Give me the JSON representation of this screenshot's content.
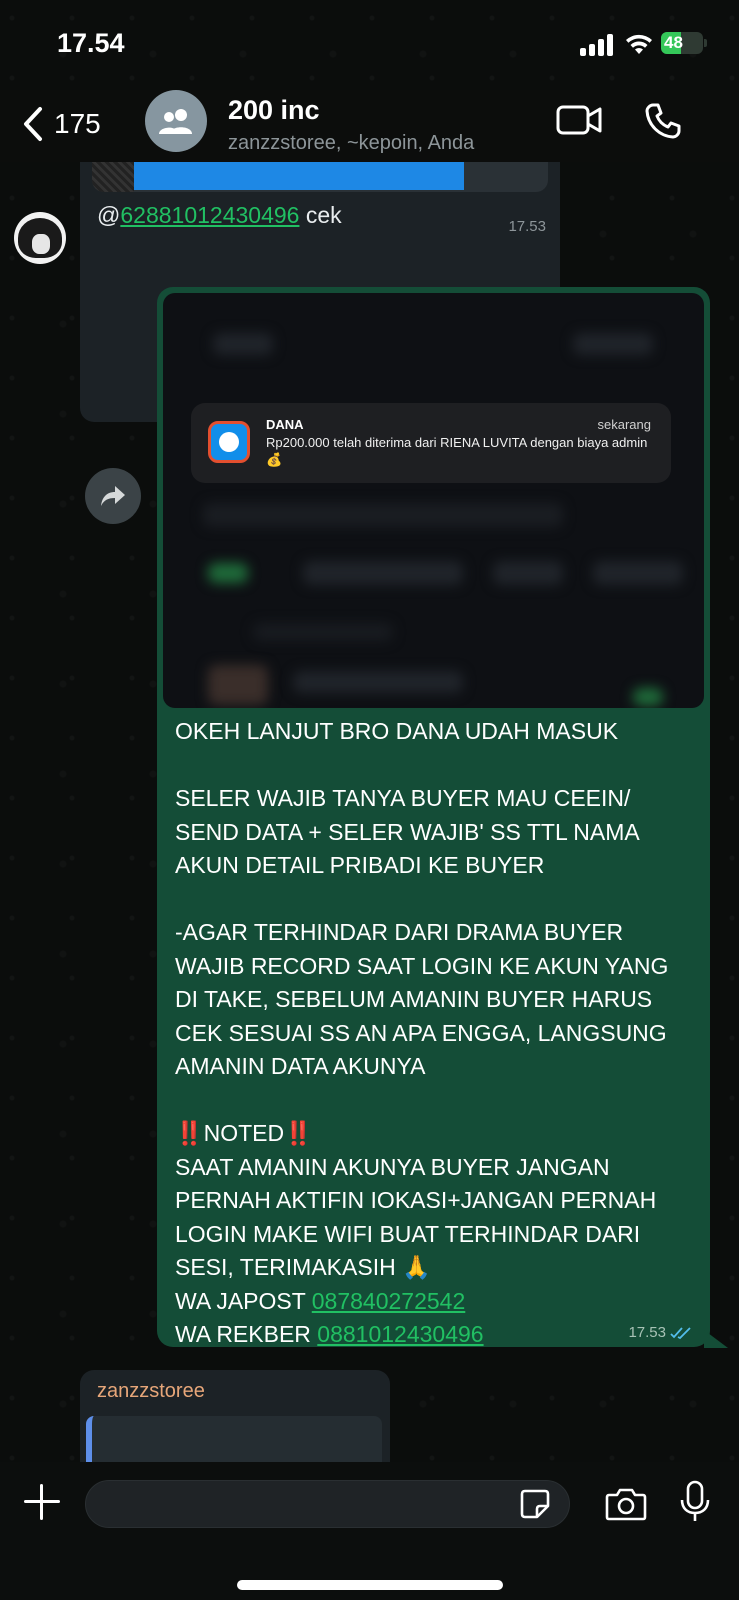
{
  "status_bar": {
    "time": "17.54",
    "battery": "48",
    "battery_fraction": 0.48
  },
  "header": {
    "back_count": "175",
    "title": "200 inc",
    "subtitle": "zanzzstoree, ~kepoin, Anda"
  },
  "messages": {
    "first": {
      "at": "@",
      "mention": "62881012430496",
      "text": " cek",
      "time": "17.53"
    },
    "main": {
      "notification": {
        "app": "DANA",
        "when": "sekarang",
        "body": "Rp200.000 telah diterima dari RIENA LUVITA dengan biaya admin 💰"
      },
      "line1": "OKEH LANJUT BRO DANA UDAH MASUK",
      "line2": "SELER WAJIB TANYA BUYER MAU CEEIN/ SEND DATA + SELER WAJIB' SS TTL NAMA AKUN DETAIL PRIBADI KE BUYER",
      "line3": "-AGAR TERHINDAR DARI DRAMA BUYER WAJIB RECORD SAAT LOGIN KE AKUN YANG DI TAKE, SEBELUM AMANIN BUYER HARUS CEK SESUAI SS AN APA ENGGA, LANGSUNG AMANIN DATA AKUNYA",
      "noted": "‼️NOTED‼️",
      "line4": "SAAT AMANIN AKUNYA BUYER JANGAN PERNAH AKTIFIN IOKASI+JANGAN PERNAH LOGIN MAKE WIFI BUAT TERHINDAR DARI SESI, TERIMAKASIH 🙏",
      "japost_label": "WA JAPOST ",
      "japost_number": "087840272542",
      "rekber_label": "WA REKBER ",
      "rekber_number": "0881012430496",
      "time": "17.53"
    },
    "last": {
      "sender": "zanzzstoree"
    }
  },
  "input": {
    "value": "",
    "placeholder": ""
  },
  "colors": {
    "outgoing": "#144d37",
    "link": "#21c063",
    "check": "#53bdeb"
  }
}
